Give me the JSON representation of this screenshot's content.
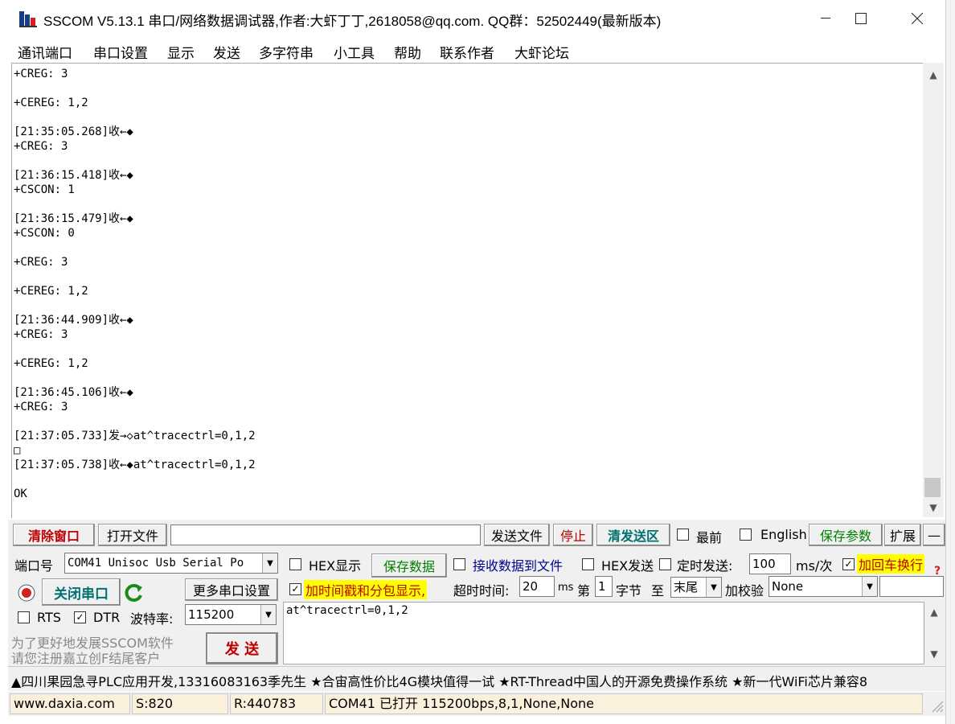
{
  "window": {
    "title": "SSCOM V5.13.1 串口/网络数据调试器,作者:大虾丁丁,2618058@qq.com. QQ群：52502449(最新版本)"
  },
  "menu": [
    "通讯端口",
    "串口设置",
    "显示",
    "发送",
    "多字符串",
    "小工具",
    "帮助",
    "联系作者",
    "大虾论坛"
  ],
  "receive_text": "+CREG: 3\n\n+CEREG: 1,2\n\n[21:35:05.268]收←◆\n+CREG: 3\n\n[21:36:15.418]收←◆\n+CSCON: 1\n\n[21:36:15.479]收←◆\n+CSCON: 0\n\n+CREG: 3\n\n+CEREG: 1,2\n\n[21:36:44.909]收←◆\n+CREG: 3\n\n+CEREG: 1,2\n\n[21:36:45.106]收←◆\n+CREG: 3\n\n[21:37:05.733]发→◇at^tracectrl=0,1,2\n□\n[21:37:05.738]收←◆at^tracectrl=0,1,2\n\nOK",
  "toolbar": {
    "clear_window": "清除窗口",
    "open_file": "打开文件",
    "file_path": "",
    "send_file": "发送文件",
    "stop": "停止",
    "clear_send": "清发送区",
    "topmost": "最前",
    "english": "English",
    "save_params": "保存参数",
    "expand": "扩展",
    "collapse": "—"
  },
  "port": {
    "port_label": "端口号",
    "port_value": "COM41 Unisoc Usb Serial Po",
    "close_port": "关闭串口",
    "more_settings": "更多串口设置",
    "rts": "RTS",
    "dtr": "DTR",
    "baud_label": "波特率:",
    "baud_value": "115200",
    "promo_line1": "为了更好地发展SSCOM软件",
    "promo_line2": "请您注册嘉立创F结尾客户",
    "send_button": "发 送"
  },
  "options": {
    "hex_display": "HEX显示",
    "save_data": "保存数据",
    "recv_to_file": "接收数据到文件",
    "hex_send": "HEX发送",
    "timed_send": "定时发送:",
    "interval": "100",
    "interval_unit": "ms/次",
    "append_newline": "加回车换行",
    "timestamp": "加时间戳和分包显示,",
    "timeout_label": "超时时间:",
    "timeout_value": "20",
    "timeout_unit": "ms",
    "byte_prefix": "第",
    "byte_value": "1",
    "byte_suffix": "字节",
    "to_label": "至",
    "to_value": "末尾",
    "checksum_label": "加校验",
    "checksum_value": "None"
  },
  "send_text": "at^tracectrl=0,1,2",
  "ticker": "▲四川果园急寻PLC应用开发,13316083163季先生 ★合宙高性价比4G模块值得一试 ★RT-Thread中国人的开源免费操作系统 ★新一代WiFi芯片兼容8",
  "status": {
    "website": "www.daxia.com",
    "sent": "S:820",
    "received": "R:440783",
    "port_state": "COM41 已打开  115200bps,8,1,None,None"
  },
  "colors": {
    "red_button": "#c00000",
    "green_text": "#008000",
    "teal_text": "#007070",
    "highlight": "#ffff00"
  }
}
